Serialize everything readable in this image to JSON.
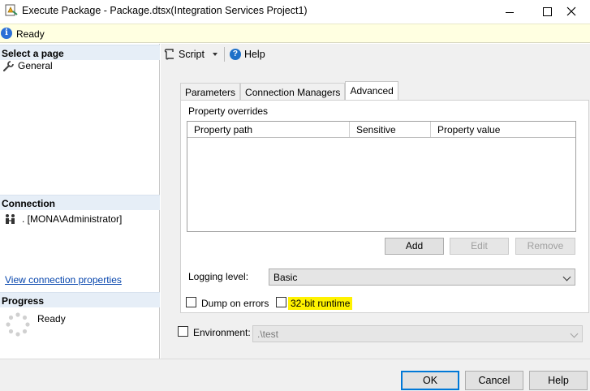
{
  "window": {
    "title": "Execute Package - Package.dtsx(Integration Services Project1)",
    "controls": [
      "minimize-icon",
      "maximize-icon",
      "close-icon"
    ]
  },
  "status": {
    "text": "Ready",
    "icon": "info-icon"
  },
  "left": {
    "select_page_header": "Select a page",
    "pages": [
      {
        "label": "General",
        "icon": "wrench-icon"
      }
    ],
    "connection_header": "Connection",
    "connection_value": ". [MONA\\Administrator]",
    "connection_icon": "server-connection-icon",
    "view_connection_link": "View connection properties",
    "progress_header": "Progress",
    "progress_status": "Ready",
    "progress_icon": "spinner-icon"
  },
  "toolbar": {
    "script_label": "Script",
    "script_icon": "script-icon",
    "help_label": "Help",
    "help_icon": "help-icon"
  },
  "tabs": [
    {
      "label": "Parameters",
      "active": false
    },
    {
      "label": "Connection Managers",
      "active": false
    },
    {
      "label": "Advanced",
      "active": true
    }
  ],
  "advanced": {
    "property_overrides_label": "Property overrides",
    "columns": [
      "Property path",
      "Sensitive",
      "Property value"
    ],
    "rows": [],
    "add_label": "Add",
    "edit_label": "Edit",
    "remove_label": "Remove",
    "logging_label": "Logging level:",
    "logging_value": "Basic",
    "dump_on_errors_label": "Dump on errors",
    "runtime_32bit_label": "32-bit runtime"
  },
  "environment": {
    "label": "Environment:",
    "value": ".\\test"
  },
  "footer": {
    "ok_label": "OK",
    "cancel_label": "Cancel",
    "help_label": "Help"
  },
  "colors": {
    "status_bg": "#ffffe1",
    "section_header_bg": "#e6eef7",
    "link": "#0645ad",
    "highlight": "#fff200",
    "default_button_border": "#0078d7"
  }
}
